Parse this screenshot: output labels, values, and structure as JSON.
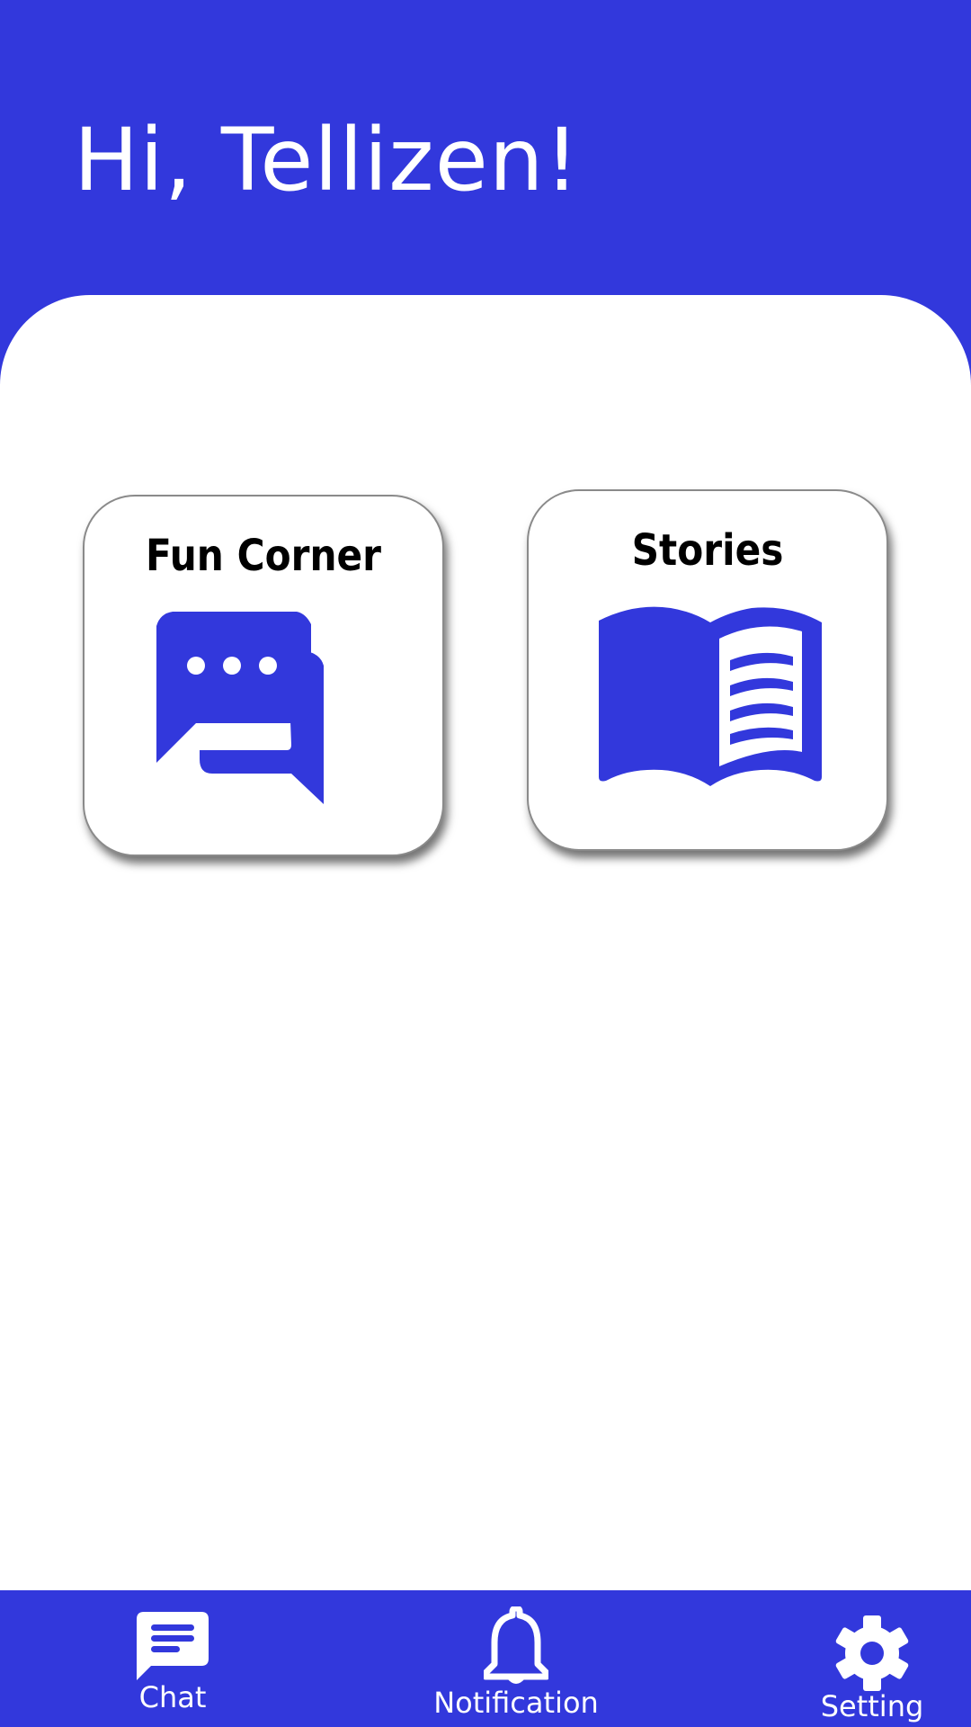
{
  "header": {
    "greeting": "Hi, Tellizen!"
  },
  "cards": [
    {
      "title": "Fun Corner",
      "icon": "chat-bubbles-icon"
    },
    {
      "title": "Stories",
      "icon": "open-book-icon"
    }
  ],
  "bottom_nav": {
    "items": [
      {
        "label": "Chat",
        "icon": "chat-icon"
      },
      {
        "label": "Notification",
        "icon": "bell-icon"
      },
      {
        "label": "Setting",
        "icon": "gear-icon"
      }
    ]
  },
  "colors": {
    "brand": "#3238dc",
    "surface": "#ffffff",
    "text": "#000000"
  }
}
